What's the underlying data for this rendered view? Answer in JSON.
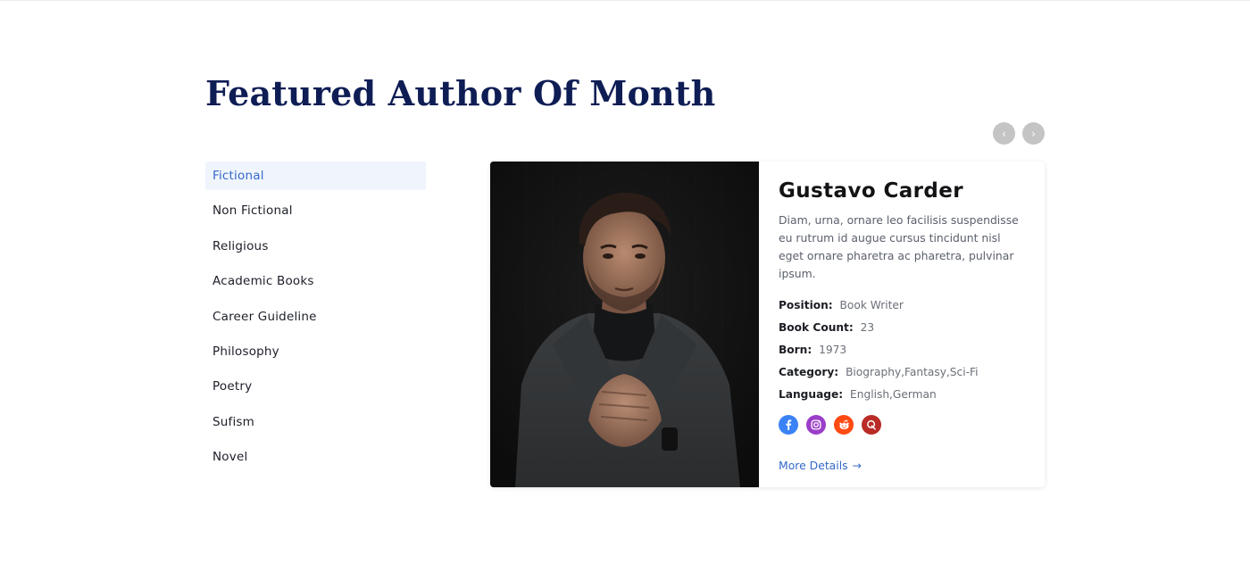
{
  "section": {
    "title": "Featured Author Of Month"
  },
  "nav": {
    "prev_icon": "chevron-left-icon",
    "next_icon": "chevron-right-icon",
    "prev_glyph": "‹",
    "next_glyph": "›"
  },
  "categories": [
    {
      "label": "Fictional",
      "active": true
    },
    {
      "label": "Non Fictional",
      "active": false
    },
    {
      "label": "Religious",
      "active": false
    },
    {
      "label": "Academic Books",
      "active": false
    },
    {
      "label": "Career Guideline",
      "active": false
    },
    {
      "label": "Philosophy",
      "active": false
    },
    {
      "label": "Poetry",
      "active": false
    },
    {
      "label": "Sufism",
      "active": false
    },
    {
      "label": "Novel",
      "active": false
    }
  ],
  "author": {
    "name": "Gustavo Carder",
    "bio": "Diam, urna, ornare leo facilisis suspendisse eu rutrum id augue cursus tincidunt nisl eget ornare pharetra ac pharetra, pulvinar ipsum.",
    "facts": [
      {
        "label": "Position:",
        "value": "Book Writer"
      },
      {
        "label": "Book Count:",
        "value": "23"
      },
      {
        "label": "Born:",
        "value": "1973"
      },
      {
        "label": "Category:",
        "value": "Biography,Fantasy,Sci-Fi"
      },
      {
        "label": "Language:",
        "value": "English,German"
      }
    ],
    "social": [
      {
        "icon": "facebook-icon",
        "color": "#3b82f6"
      },
      {
        "icon": "instagram-icon",
        "color": "#9b3ec9"
      },
      {
        "icon": "reddit-icon",
        "color": "#ff4a12"
      },
      {
        "icon": "quora-icon",
        "color": "#b92b27"
      }
    ],
    "more_label": "More Details",
    "more_arrow": "→"
  },
  "colors": {
    "title": "#0f1d55",
    "accent": "#3468c8",
    "active_bg": "#f0f5fd",
    "arrow_bg": "#c4c4c4"
  }
}
